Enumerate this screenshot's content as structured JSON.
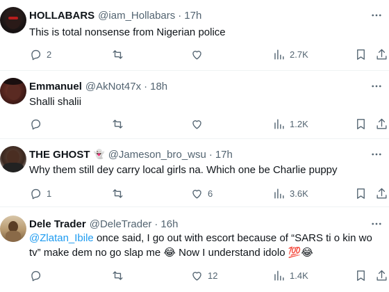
{
  "tweets": [
    {
      "name": "HOLLABARS",
      "handle": "@iam_Hollabars",
      "time": "17h",
      "text": "This is total nonsense from Nigerian police",
      "replies": "2",
      "retweets": "",
      "likes": "",
      "views": "2.7K"
    },
    {
      "name": "Emmanuel",
      "handle": "@AkNot47x",
      "time": "18h",
      "text": "Shalli shalii",
      "replies": "",
      "retweets": "",
      "likes": "",
      "views": "1.2K"
    },
    {
      "name": "THE GHOST",
      "name_emoji": "👻",
      "handle": "@Jameson_bro_wsu",
      "time": "17h",
      "text": "Why them still dey carry local girls na. Which one be Charlie puppy",
      "replies": "1",
      "retweets": "",
      "likes": "6",
      "views": "3.6K"
    },
    {
      "name": "Dele Trader",
      "handle": "@DeleTrader",
      "time": "16h",
      "mention": "@Zlatan_Ibile",
      "text_line1": " once said, I go out with escort because of “SARS ti o kin wo",
      "text_line2": "tv” make dem no go slap me 😂 Now I understand idolo 💯😂",
      "replies": "",
      "retweets": "",
      "likes": "12",
      "views": "1.4K"
    }
  ],
  "separator": "·",
  "colors": {
    "text": "#0f1419",
    "secondary": "#536471",
    "link": "#1d9bf0",
    "divider": "#eff3f4"
  },
  "icons": [
    "more-icon",
    "reply-icon",
    "retweet-icon",
    "like-icon",
    "views-icon",
    "bookmark-icon",
    "share-icon"
  ]
}
